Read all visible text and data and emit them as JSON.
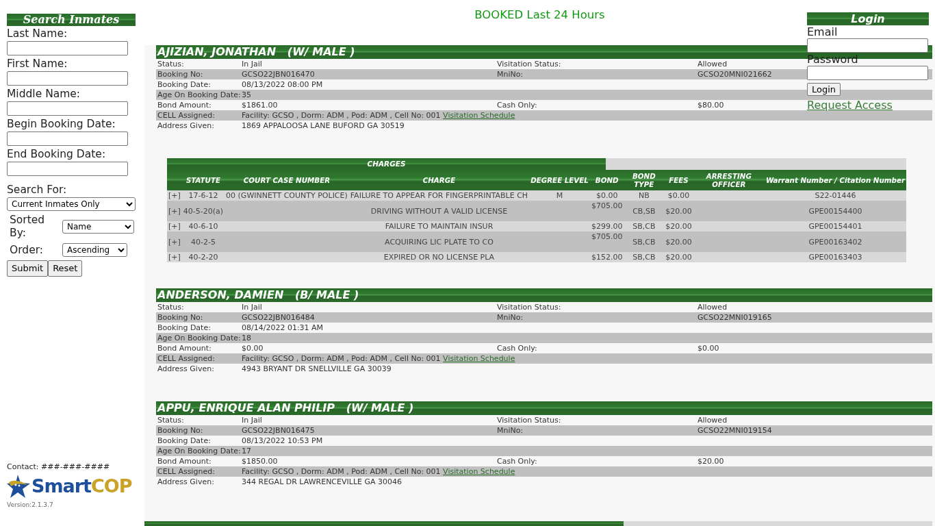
{
  "search_panel": {
    "title": "Search Inmates",
    "fields": [
      {
        "label": "Last Name:"
      },
      {
        "label": "First Name:"
      },
      {
        "label": "Middle Name:"
      },
      {
        "label": "Begin Booking Date:"
      },
      {
        "label": "End Booking Date:"
      }
    ],
    "search_for": {
      "label": "Search For:",
      "value": "Current Inmates Only"
    },
    "sorted_by": {
      "label": "Sorted By:",
      "value": "Name"
    },
    "order": {
      "label": "Order:",
      "value": "Ascending"
    },
    "buttons": [
      "Submit",
      "Reset"
    ]
  },
  "footer": {
    "contact": "Contact: ###-###-####",
    "logo_word_1": "Smart",
    "logo_word_2": "COP",
    "version": "Version:2.1.3.7"
  },
  "page_title": "BOOKED Last 24 Hours",
  "login": {
    "title": "Login",
    "email_label": "Email",
    "password_label": "Password",
    "button": "Login",
    "link": "Request Access"
  },
  "inmates": [
    {
      "name": "AJIZIAN, JONATHAN   (W/ MALE )",
      "rows": [
        {
          "label": "Status:",
          "value": "In Jail",
          "label_2": "Visitation Status:",
          "value_2": "Allowed"
        },
        {
          "label": "Booking No:",
          "value": "GCSO22JBN016470",
          "label_2": "MniNo:",
          "value_2": "GCSO20MNI021662"
        },
        {
          "label": "Booking Date:",
          "value": "08/13/2022 08:00 PM"
        },
        {
          "label": "Age On Booking Date:",
          "value": "35"
        },
        {
          "label": "Bond Amount:",
          "value": "$1861.00",
          "label_2": "Cash Only:",
          "value_2": "$80.00"
        },
        {
          "label": "CELL Assigned:",
          "value": "Facility: GCSO , Dorm: ADM , Pod: ADM , Cell No: 001",
          "link": "Visitation Schedule"
        },
        {
          "label": "Address Given:",
          "value": "1869 APPALOOSA LANE BUFORD GA 30519"
        }
      ],
      "charges": {
        "title": "CHARGES",
        "columns": [
          "STATUTE",
          "COURT CASE NUMBER",
          "CHARGE",
          "DEGREE LEVEL",
          "BOND",
          "BOND TYPE",
          "FEES",
          "ARRESTING OFFICER",
          "Warrant Number / Citation Number"
        ],
        "rows": [
          {
            "expander": "[+]",
            "cells": [
              "17-6-12",
              "00 (GWINNETT COUNTY POLICE)",
              "FAILURE TO APPEAR FOR FINGERPRINTABLE CH",
              "M",
              "$0.00",
              "NB",
              "$0.00",
              "",
              "S22-01446"
            ]
          },
          {
            "expander": "[+]",
            "cells": [
              "40-5-20(a)",
              "",
              "DRIVING WITHOUT A VALID LICENSE",
              "",
              "$705.00",
              "CB,SB",
              "$20.00",
              "",
              "GPE00154400"
            ]
          },
          {
            "expander": "[+]",
            "cells": [
              "40-6-10",
              "",
              "FAILURE TO MAINTAIN INSUR",
              "",
              "$299.00",
              "SB,CB",
              "$20.00",
              "",
              "GPE00154401"
            ]
          },
          {
            "expander": "[+]",
            "cells": [
              "40-2-5",
              "",
              "ACQUIRING LIC PLATE TO CO",
              "",
              "$705.00",
              "SB,CB",
              "$20.00",
              "",
              "GPE00163402"
            ]
          },
          {
            "expander": "[+]",
            "cells": [
              "40-2-20",
              "",
              "EXPIRED OR NO LICENSE PLA",
              "",
              "$152.00",
              "SB,CB",
              "$20.00",
              "",
              "GPE00163403"
            ]
          }
        ]
      }
    },
    {
      "name": "ANDERSON, DAMIEN   (B/ MALE )",
      "rows": [
        {
          "label": "Status:",
          "value": "In Jail",
          "label_2": "Visitation Status:",
          "value_2": "Allowed"
        },
        {
          "label": "Booking No:",
          "value": "GCSO22JBN016484",
          "label_2": "MniNo:",
          "value_2": "GCSO22MNI019165"
        },
        {
          "label": "Booking Date:",
          "value": "08/14/2022 01:31 AM"
        },
        {
          "label": "Age On Booking Date:",
          "value": "18"
        },
        {
          "label": "Bond Amount:",
          "value": "$0.00",
          "label_2": "Cash Only:",
          "value_2": "$0.00"
        },
        {
          "label": "CELL Assigned:",
          "value": "Facility: GCSO , Dorm: ADM , Pod: ADM , Cell No: 001",
          "link": "Visitation Schedule"
        },
        {
          "label": "Address Given:",
          "value": "4943 BRYANT DR SNELLVILLE GA 30039"
        }
      ]
    },
    {
      "name": "APPU, ENRIQUE ALAN PHILIP   (W/ MALE )",
      "rows": [
        {
          "label": "Status:",
          "value": "In Jail",
          "label_2": "Visitation Status:",
          "value_2": "Allowed"
        },
        {
          "label": "Booking No:",
          "value": "GCSO22JBN016475",
          "label_2": "MniNo:",
          "value_2": "GCSO22MNI019154"
        },
        {
          "label": "Booking Date:",
          "value": "08/13/2022 10:53 PM"
        },
        {
          "label": "Age On Booking Date:",
          "value": "17"
        },
        {
          "label": "Bond Amount:",
          "value": "$1850.00",
          "label_2": "Cash Only:",
          "value_2": "$20.00"
        },
        {
          "label": "CELL Assigned:",
          "value": "Facility: GCSO , Dorm: ADM , Pod: ADM , Cell No: 001",
          "link": "Visitation Schedule"
        },
        {
          "label": "Address Given:",
          "value": "344 REGAL DR LAWRENCEVILLE GA 30046"
        }
      ],
      "charges_cut_off": true
    }
  ]
}
